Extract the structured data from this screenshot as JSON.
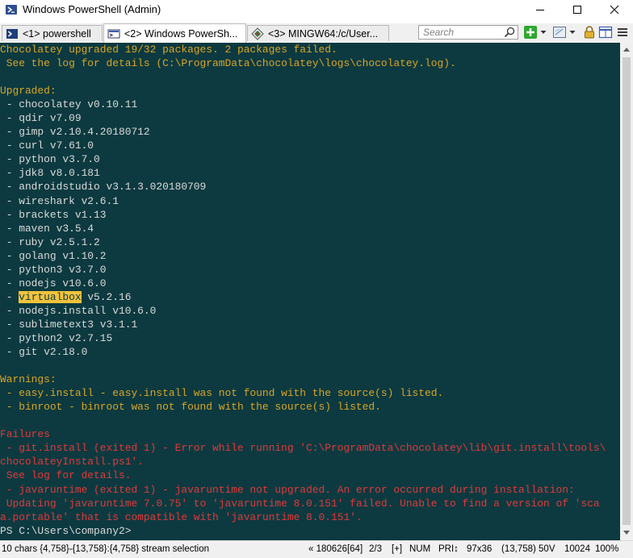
{
  "window": {
    "title": "Windows PowerShell (Admin)"
  },
  "tabs": [
    {
      "label": "<1> powershell",
      "icon": "terminal-icon"
    },
    {
      "label": "<2> Windows PowerSh...",
      "icon": "powershell-icon"
    },
    {
      "label": "<3> MINGW64:/c/User...",
      "icon": "git-diamond-icon"
    }
  ],
  "search": {
    "placeholder": "Search"
  },
  "console": {
    "lines": [
      {
        "parts": [
          {
            "text": "Chocolatey upgraded 19/32 packages. 2 packages failed.",
            "color": "yellow"
          }
        ]
      },
      {
        "parts": [
          {
            "text": " See the log for details (C:\\ProgramData\\chocolatey\\logs\\chocolatey.log).",
            "color": "yellow"
          }
        ]
      },
      {
        "parts": [
          {
            "text": "",
            "color": "gray"
          }
        ]
      },
      {
        "parts": [
          {
            "text": "Upgraded:",
            "color": "yellow"
          }
        ]
      },
      {
        "parts": [
          {
            "text": " - chocolatey v0.10.11",
            "color": "gray"
          }
        ]
      },
      {
        "parts": [
          {
            "text": " - qdir v7.09",
            "color": "gray"
          }
        ]
      },
      {
        "parts": [
          {
            "text": " - gimp v2.10.4.20180712",
            "color": "gray"
          }
        ]
      },
      {
        "parts": [
          {
            "text": " - curl v7.61.0",
            "color": "gray"
          }
        ]
      },
      {
        "parts": [
          {
            "text": " - python v3.7.0",
            "color": "gray"
          }
        ]
      },
      {
        "parts": [
          {
            "text": " - jdk8 v8.0.181",
            "color": "gray"
          }
        ]
      },
      {
        "parts": [
          {
            "text": " - androidstudio v3.1.3.020180709",
            "color": "gray"
          }
        ]
      },
      {
        "parts": [
          {
            "text": " - wireshark v2.6.1",
            "color": "gray"
          }
        ]
      },
      {
        "parts": [
          {
            "text": " - brackets v1.13",
            "color": "gray"
          }
        ]
      },
      {
        "parts": [
          {
            "text": " - maven v3.5.4",
            "color": "gray"
          }
        ]
      },
      {
        "parts": [
          {
            "text": " - ruby v2.5.1.2",
            "color": "gray"
          }
        ]
      },
      {
        "parts": [
          {
            "text": " - golang v1.10.2",
            "color": "gray"
          }
        ]
      },
      {
        "parts": [
          {
            "text": " - python3 v3.7.0",
            "color": "gray"
          }
        ]
      },
      {
        "parts": [
          {
            "text": " - nodejs v10.6.0",
            "color": "gray"
          }
        ]
      },
      {
        "parts": [
          {
            "text": " - ",
            "color": "gray"
          },
          {
            "text": "virtualbox",
            "color": "hl"
          },
          {
            "text": " v5.2.16",
            "color": "gray"
          }
        ]
      },
      {
        "parts": [
          {
            "text": " - nodejs.install v10.6.0",
            "color": "gray"
          }
        ]
      },
      {
        "parts": [
          {
            "text": " - sublimetext3 v3.1.1",
            "color": "gray"
          }
        ]
      },
      {
        "parts": [
          {
            "text": " - python2 v2.7.15",
            "color": "gray"
          }
        ]
      },
      {
        "parts": [
          {
            "text": " - git v2.18.0",
            "color": "gray"
          }
        ]
      },
      {
        "parts": [
          {
            "text": "",
            "color": "gray"
          }
        ]
      },
      {
        "parts": [
          {
            "text": "Warnings:",
            "color": "yellow"
          }
        ]
      },
      {
        "parts": [
          {
            "text": " - easy.install - easy.install was not found with the source(s) listed.",
            "color": "yellow"
          }
        ]
      },
      {
        "parts": [
          {
            "text": " - binroot - binroot was not found with the source(s) listed.",
            "color": "yellow"
          }
        ]
      },
      {
        "parts": [
          {
            "text": "",
            "color": "gray"
          }
        ]
      },
      {
        "parts": [
          {
            "text": "Failures",
            "color": "red"
          }
        ]
      },
      {
        "parts": [
          {
            "text": " - git.install (exited 1) - Error while running 'C:\\ProgramData\\chocolatey\\lib\\git.install\\tools\\",
            "color": "red"
          }
        ]
      },
      {
        "parts": [
          {
            "text": "chocolateyInstall.ps1'.",
            "color": "red"
          }
        ]
      },
      {
        "parts": [
          {
            "text": " See log for details.",
            "color": "red"
          }
        ]
      },
      {
        "parts": [
          {
            "text": " - javaruntime (exited 1) - javaruntime not upgraded. An error occurred during installation:",
            "color": "red"
          }
        ]
      },
      {
        "parts": [
          {
            "text": " Updating 'javaruntime 7.0.75' to 'javaruntime 8.0.151' failed. Unable to find a version of 'sca",
            "color": "red"
          }
        ]
      },
      {
        "parts": [
          {
            "text": "a.portable' that is compatible with 'javaruntime 8.0.151'.",
            "color": "red"
          }
        ]
      },
      {
        "parts": [
          {
            "text": "PS C:\\Users\\company2>",
            "color": "gray"
          }
        ]
      }
    ]
  },
  "statusbar": {
    "selection": "10 chars {4,758}-{13,758}:{4,758} stream selection",
    "info": "« 180626[64]",
    "tabpos": "2/3",
    "plus": "[+]",
    "num": "NUM",
    "pri": "PRI↕",
    "size": "97x36",
    "coords": "(13,758) 50V",
    "pid": "10024",
    "zoom": "100%"
  },
  "colors": {
    "console_bg": "#0c3a40",
    "yellow": "#d9a527",
    "gray": "#dadada",
    "red": "#e1393b",
    "highlight": "#f2c33b"
  }
}
